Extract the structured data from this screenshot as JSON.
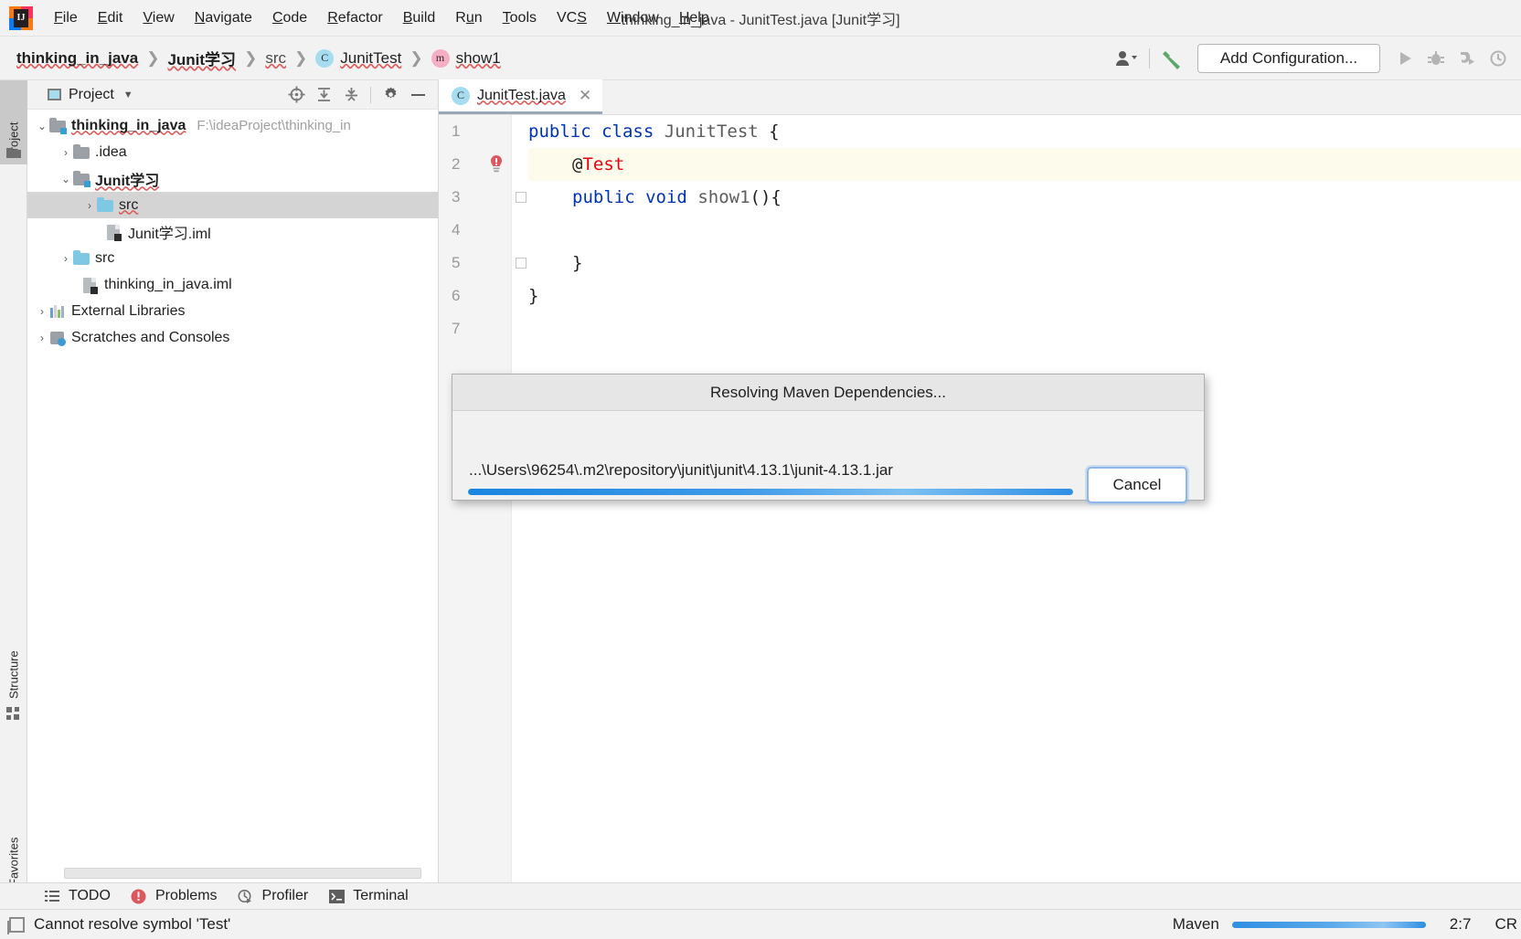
{
  "window": {
    "title": "thinking_in_java - JunitTest.java [Junit学习]",
    "logo_letter": "IJ"
  },
  "menu": {
    "items": [
      {
        "name": "file",
        "label": "File",
        "mnemonic": "F"
      },
      {
        "name": "edit",
        "label": "Edit",
        "mnemonic": "E"
      },
      {
        "name": "view",
        "label": "View",
        "mnemonic": "V"
      },
      {
        "name": "navigate",
        "label": "Navigate",
        "mnemonic": "N"
      },
      {
        "name": "code",
        "label": "Code",
        "mnemonic": "C"
      },
      {
        "name": "refactor",
        "label": "Refactor",
        "mnemonic": "R"
      },
      {
        "name": "build",
        "label": "Build",
        "mnemonic": "B"
      },
      {
        "name": "run",
        "label": "Run",
        "mnemonic": "u"
      },
      {
        "name": "tools",
        "label": "Tools",
        "mnemonic": "T"
      },
      {
        "name": "vcs",
        "label": "VCS",
        "mnemonic": "S"
      },
      {
        "name": "window",
        "label": "Window",
        "mnemonic": "W"
      },
      {
        "name": "help",
        "label": "Help",
        "mnemonic": "H"
      }
    ]
  },
  "navbar": {
    "breadcrumbs": [
      {
        "label": "thinking_in_java",
        "style": "bold",
        "icon": "none"
      },
      {
        "label": "Junit学习",
        "style": "bold",
        "icon": "none"
      },
      {
        "label": "src",
        "style": "plain",
        "icon": "none"
      },
      {
        "label": "JunitTest",
        "style": "plain",
        "icon": "class-badge"
      },
      {
        "label": "show1",
        "style": "plain",
        "icon": "method-badge"
      }
    ],
    "separator": "❯",
    "add_configuration_label": "Add Configuration...",
    "icons": [
      "user-group-icon",
      "build-hammer-icon",
      "run-icon",
      "debug-icon",
      "run-coverage-icon",
      "profile-icon"
    ]
  },
  "left_strip": {
    "buttons": [
      {
        "name": "project",
        "label": "Project",
        "icon": "folder-icon",
        "active": true
      },
      {
        "name": "structure",
        "label": "Structure",
        "icon": "structure-icon",
        "active": false
      },
      {
        "name": "favorites",
        "label": "Favorites",
        "icon": "star-icon",
        "active": false
      }
    ]
  },
  "project_panel": {
    "title": "Project",
    "toolbar_icons": [
      "locate-icon",
      "expand-all-icon",
      "collapse-all-icon",
      "gear-icon",
      "hide-icon"
    ],
    "tree": [
      {
        "name": "thinking_in_java",
        "label": "thinking_in_java",
        "path": "F:\\ideaProject\\thinking_in",
        "depth": 0,
        "arrow": "expanded",
        "icon": "module-folder-icon",
        "bold": true,
        "selected": false
      },
      {
        "name": "idea",
        "label": ".idea",
        "path": "",
        "depth": 1,
        "arrow": "collapsed",
        "icon": "folder-icon",
        "bold": false,
        "selected": false
      },
      {
        "name": "junit-xuexi",
        "label": "Junit学习",
        "path": "",
        "depth": 1,
        "arrow": "expanded",
        "icon": "module-folder-icon",
        "bold": true,
        "selected": false
      },
      {
        "name": "junit-src",
        "label": "src",
        "path": "",
        "depth": 2,
        "arrow": "collapsed",
        "icon": "source-folder-icon",
        "bold": false,
        "selected": true
      },
      {
        "name": "junit-iml",
        "label": "Junit学习.iml",
        "path": "",
        "depth": 2,
        "arrow": "none",
        "icon": "iml-file-icon",
        "bold": false,
        "selected": false
      },
      {
        "name": "root-src",
        "label": "src",
        "path": "",
        "depth": 1,
        "arrow": "collapsed",
        "icon": "source-folder-icon",
        "bold": false,
        "selected": false
      },
      {
        "name": "root-iml",
        "label": "thinking_in_java.iml",
        "path": "",
        "depth": 1,
        "arrow": "none",
        "icon": "iml-file-icon",
        "bold": false,
        "selected": false
      },
      {
        "name": "external-libraries",
        "label": "External Libraries",
        "path": "",
        "depth": 0,
        "arrow": "collapsed",
        "icon": "libraries-icon",
        "bold": false,
        "selected": false
      },
      {
        "name": "scratches",
        "label": "Scratches and Consoles",
        "path": "",
        "depth": 0,
        "arrow": "collapsed",
        "icon": "scratches-icon",
        "bold": false,
        "selected": false
      }
    ]
  },
  "editor": {
    "tab": {
      "label": "JunitTest.java",
      "icon": "class-badge",
      "close": "✕"
    },
    "lines": [
      {
        "num": "1",
        "highlighted": false,
        "warn": false,
        "fold": "none",
        "tokens": [
          {
            "t": "public",
            "c": "kw"
          },
          {
            "t": " ",
            "c": "pln"
          },
          {
            "t": "class",
            "c": "kw"
          },
          {
            "t": " ",
            "c": "pln"
          },
          {
            "t": "JunitTest",
            "c": "cls"
          },
          {
            "t": " {",
            "c": "pln"
          }
        ]
      },
      {
        "num": "2",
        "highlighted": true,
        "warn": true,
        "fold": "none",
        "indent": 2,
        "tokens": [
          {
            "t": "@",
            "c": "pln"
          },
          {
            "t": "Test",
            "c": "err"
          }
        ]
      },
      {
        "num": "3",
        "highlighted": false,
        "warn": false,
        "fold": "start",
        "indent": 2,
        "tokens": [
          {
            "t": "public",
            "c": "kw"
          },
          {
            "t": " ",
            "c": "pln"
          },
          {
            "t": "void",
            "c": "kw"
          },
          {
            "t": " ",
            "c": "pln"
          },
          {
            "t": "show1",
            "c": "cls"
          },
          {
            "t": "(){",
            "c": "pln"
          }
        ]
      },
      {
        "num": "4",
        "highlighted": false,
        "warn": false,
        "fold": "none",
        "tokens": []
      },
      {
        "num": "5",
        "highlighted": false,
        "warn": false,
        "fold": "end",
        "indent": 2,
        "tokens": [
          {
            "t": "}",
            "c": "pln"
          }
        ]
      },
      {
        "num": "6",
        "highlighted": false,
        "warn": false,
        "fold": "none",
        "indent": 0,
        "tokens": [
          {
            "t": "}",
            "c": "pln"
          }
        ]
      },
      {
        "num": "7",
        "highlighted": false,
        "warn": false,
        "fold": "none",
        "tokens": []
      }
    ]
  },
  "dialog": {
    "title": "Resolving Maven Dependencies...",
    "message": "...\\Users\\96254\\.m2\\repository\\junit\\junit\\4.13.1\\junit-4.13.1.jar",
    "progress_percent": 100,
    "cancel_label": "Cancel"
  },
  "bottom_bar": {
    "items": [
      {
        "name": "todo",
        "label": "TODO",
        "icon": "list-icon"
      },
      {
        "name": "problems",
        "label": "Problems",
        "icon": "error-circle-icon"
      },
      {
        "name": "profiler",
        "label": "Profiler",
        "icon": "profiler-icon"
      },
      {
        "name": "terminal",
        "label": "Terminal",
        "icon": "terminal-icon"
      }
    ]
  },
  "status_bar": {
    "message": "Cannot resolve symbol 'Test'",
    "background_task": "Maven",
    "background_progress_percent": 100,
    "caret_position": "2:7",
    "line_separator": "CR"
  },
  "colors": {
    "accent_blue": "#2f8fe3",
    "error_red": "#e8000d",
    "keyword_blue": "#0033b3",
    "selection_grey": "#d4d4d4",
    "highlight_line": "#fcfbec"
  }
}
